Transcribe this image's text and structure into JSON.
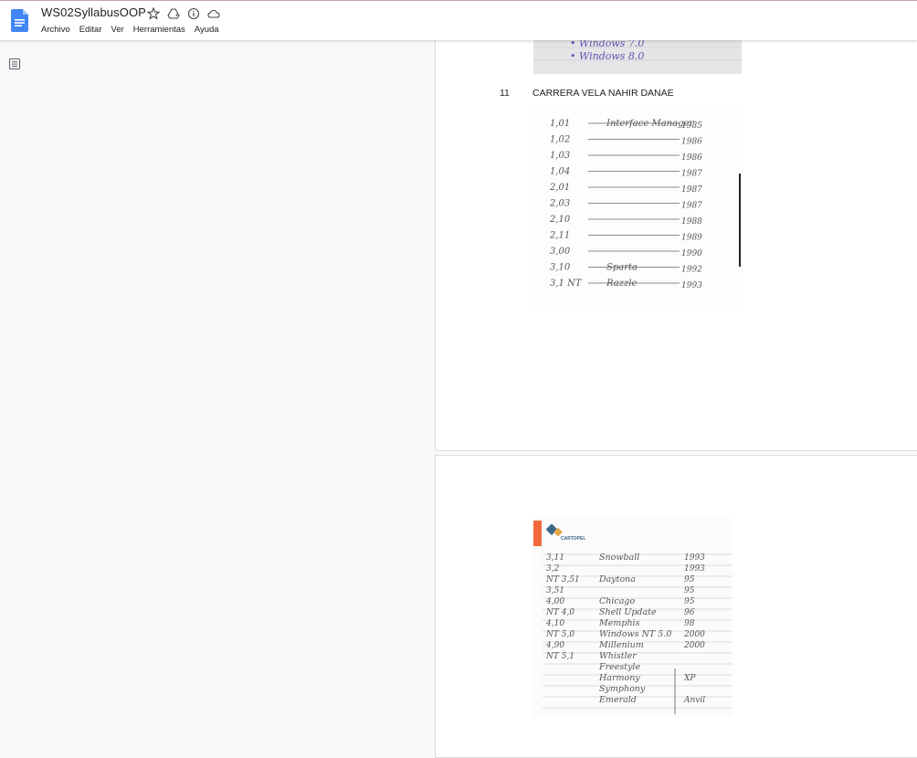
{
  "app": {
    "doc_title": "WS02SyllabusOOP",
    "menu": [
      "Archivo",
      "Editar",
      "Ver",
      "Herramientas",
      "Ayuda"
    ]
  },
  "toolbar_icons": [
    "star-icon",
    "move-to-drive-icon",
    "info-icon",
    "cloud-status-icon"
  ],
  "document": {
    "entry": {
      "number": "11",
      "name": "CARRERA VELA NAHIR DANAE"
    },
    "image1_text": [
      "• Windows 7.0",
      "• Windows 8.0"
    ],
    "image2_rows": [
      {
        "version": "1,01",
        "name": "Interface Manager",
        "year": "1985"
      },
      {
        "version": "1,02",
        "name": "",
        "year": "1986"
      },
      {
        "version": "1,03",
        "name": "",
        "year": "1986"
      },
      {
        "version": "1,04",
        "name": "",
        "year": "1987"
      },
      {
        "version": "2,01",
        "name": "",
        "year": "1987"
      },
      {
        "version": "2,03",
        "name": "",
        "year": "1987"
      },
      {
        "version": "2,10",
        "name": "",
        "year": "1988"
      },
      {
        "version": "2,11",
        "name": "",
        "year": "1989"
      },
      {
        "version": "3,00",
        "name": "",
        "year": "1990"
      },
      {
        "version": "3,10",
        "name": "Sparta",
        "year": "1992"
      },
      {
        "version": "3,1 NT",
        "name": "Razzle",
        "year": "1993"
      }
    ],
    "image3_logo": "CARTOPEL",
    "image3_rows": [
      {
        "version": "3,11",
        "name": "Snowball",
        "year": "1993"
      },
      {
        "version": "3,2",
        "name": "",
        "year": "1993"
      },
      {
        "version": "NT 3,51",
        "name": "Daytona",
        "year": "95"
      },
      {
        "version": "3,51",
        "name": "",
        "year": "95"
      },
      {
        "version": "4,00",
        "name": "Chicago",
        "year": "95"
      },
      {
        "version": "NT 4,0",
        "name": "Shell Update",
        "year": "96"
      },
      {
        "version": "4,10",
        "name": "Memphis",
        "year": "98"
      },
      {
        "version": "NT 5,0",
        "name": "Windows NT 5.0",
        "year": "2000"
      },
      {
        "version": "4,90",
        "name": "Millenium",
        "year": "2000"
      },
      {
        "version": "NT 5,1",
        "name": "Whistler",
        "year": ""
      },
      {
        "version": "",
        "name": "Freestyle",
        "year": ""
      },
      {
        "version": "",
        "name": "Harmony",
        "year": "XP"
      },
      {
        "version": "",
        "name": "Symphony",
        "year": ""
      },
      {
        "version": "",
        "name": "Emerald",
        "year": "Anvil"
      }
    ]
  },
  "colors": {
    "brand_blue": "#4285f4",
    "accent_orange": "#f26a3a"
  }
}
